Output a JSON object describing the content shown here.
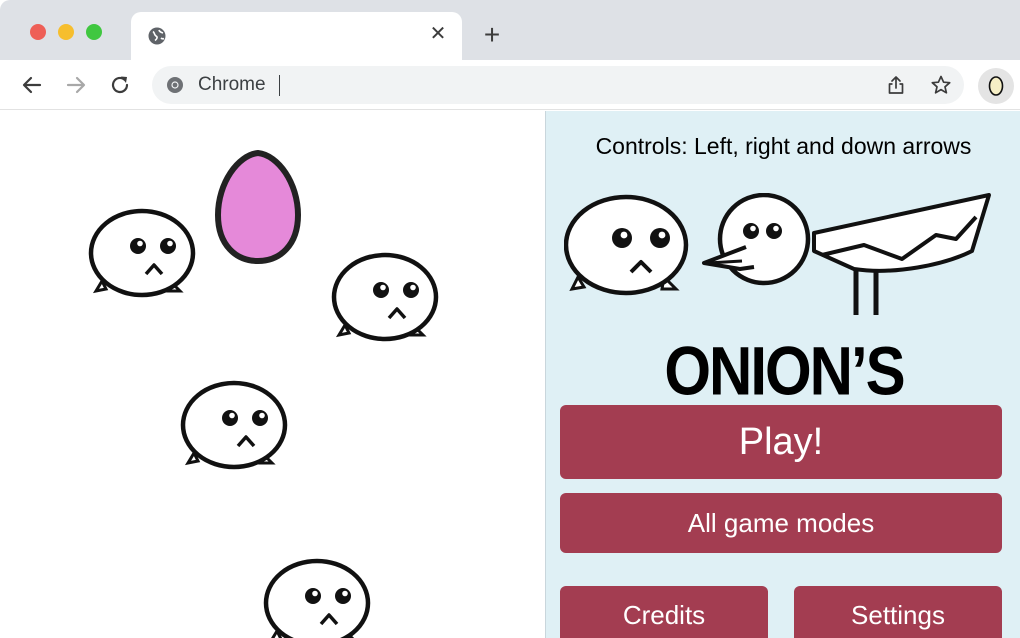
{
  "browser": {
    "window_controls": [
      "close",
      "minimize",
      "maximize"
    ],
    "tab": {
      "title": "",
      "icon": "globe-icon",
      "close_glyph": "✕"
    },
    "new_tab_glyph": "+",
    "toolbar": {
      "back_icon": "back-arrow-icon",
      "forward_icon": "forward-arrow-icon",
      "reload_icon": "reload-icon",
      "omnibox_text": "Chrome",
      "omnibox_icon": "chrome-logo-icon",
      "share_icon": "share-icon",
      "bookmark_icon": "star-icon",
      "extension_icon": "onion-icon"
    }
  },
  "game_area": {
    "characters": [
      "onion",
      "onion",
      "onion",
      "onion"
    ],
    "egg_color": "#e589d9"
  },
  "popup": {
    "controls_text": "Controls: Left, right and down arrows",
    "title": "ONION’S REVENGE",
    "buttons": {
      "play": "Play!",
      "modes": "All game modes",
      "credits": "Credits",
      "settings": "Settings"
    },
    "colors": {
      "background": "#dff0f5",
      "button": "#a33d51",
      "button_text": "#ffffff"
    }
  }
}
